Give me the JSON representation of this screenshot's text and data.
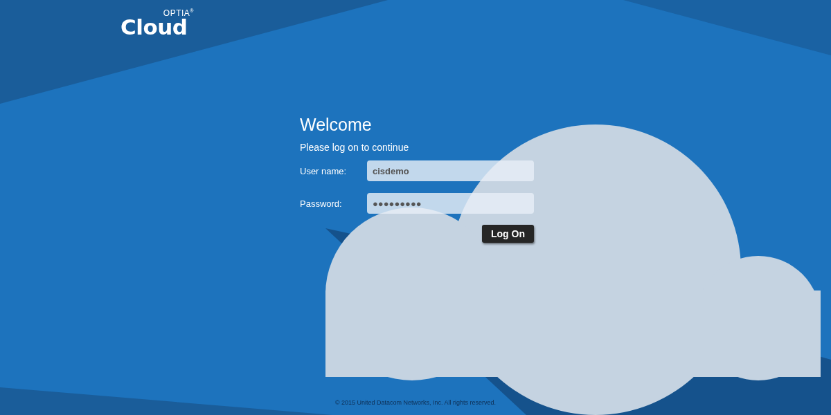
{
  "logo": {
    "superscript": "OPTIA",
    "registered": "®",
    "name": "Cloud"
  },
  "form": {
    "title": "Welcome",
    "subtitle": "Please log on to continue",
    "fields": [
      {
        "label": "User name:",
        "value": "cisdemo"
      },
      {
        "label": "Password:",
        "value": "●●●●●●●●●"
      }
    ],
    "button": "Log On"
  },
  "footer": "© 2015 United Datacom Networks, Inc. All rights reserved."
}
